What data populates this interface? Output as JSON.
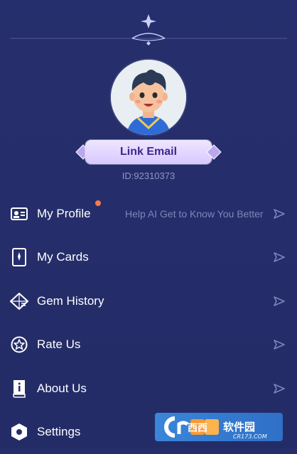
{
  "profile": {
    "link_email_label": "Link Email",
    "user_id": "ID:92310373"
  },
  "menu": {
    "items": [
      {
        "label": "My Profile",
        "hint": "Help AI Get to Know You Better",
        "icon": "id-card-icon",
        "has_dot": true
      },
      {
        "label": "My Cards",
        "hint": "",
        "icon": "tarot-card-icon",
        "has_dot": false
      },
      {
        "label": "Gem History",
        "hint": "",
        "icon": "gem-icon",
        "has_dot": false
      },
      {
        "label": "Rate Us",
        "hint": "",
        "icon": "star-badge-icon",
        "has_dot": false
      },
      {
        "label": "About Us",
        "hint": "",
        "icon": "info-book-icon",
        "has_dot": false
      },
      {
        "label": "Settings",
        "hint": "",
        "icon": "hexagon-gear-icon",
        "has_dot": false
      }
    ]
  },
  "colors": {
    "background": "#262f6b",
    "pill": "#e3d6ff",
    "notification_dot": "#ff7a45",
    "muted_text": "#8f96c4"
  },
  "watermark": {
    "text_main": "西西软件园",
    "text_sub": "CR173.COM"
  }
}
